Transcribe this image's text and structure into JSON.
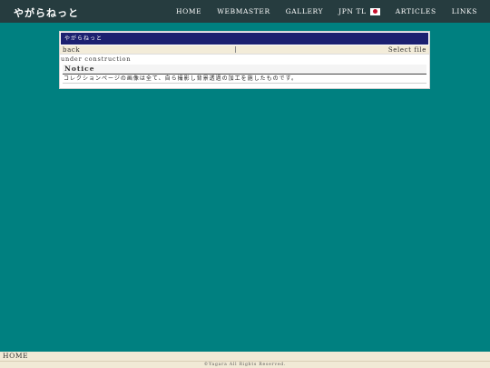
{
  "header": {
    "brand": "やがらねっと",
    "nav": {
      "home": "HOME",
      "webmaster": "WEBMASTER",
      "gallery": "GALLERY",
      "jpn_tl": "JPN TL",
      "articles": "ARTICLES",
      "links": "LINKS"
    },
    "flag_icon": "japan-flag-icon"
  },
  "window": {
    "title": "やがらねっと",
    "toolbar": {
      "back_label": "back",
      "select_label": "Select file"
    },
    "status": "under construction",
    "notice": {
      "heading": "Notice",
      "body": "コレクションページの画像は全て、自ら撮影し背景透過の加工を施したものです。"
    }
  },
  "footer": {
    "home": "HOME",
    "copyright": "©Yagara All Rights Reserved."
  },
  "colors": {
    "background": "#008080",
    "topbar": "#263c3f",
    "window_title": "#1c2070",
    "toolbar": "#f3ecd9",
    "footer": "#f1ead6"
  }
}
